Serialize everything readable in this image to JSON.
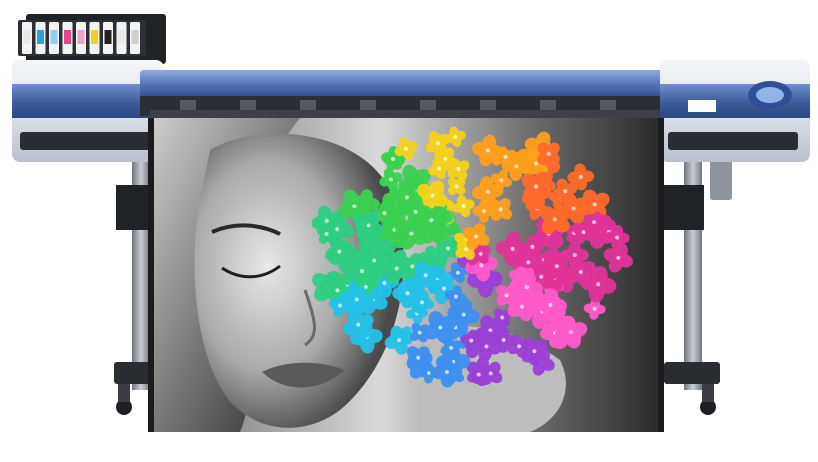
{
  "scene": {
    "subject": "wide-format-inkjet-printer",
    "print_subject": "woman-face-with-rainbow-hydrangea",
    "colors": {
      "background": "#ffffff",
      "printer_blue": "#3f5f9f",
      "printer_body": "#dfe3ea",
      "frame_dark": "#1f2226",
      "stand_grey": "#9aa0a8"
    },
    "ink_cartridges": [
      {
        "name": "ink-cartridge-1",
        "color": "#e9e9e9"
      },
      {
        "name": "ink-cartridge-2",
        "color": "#2aa3dd"
      },
      {
        "name": "ink-cartridge-3",
        "color": "#8fd0ee"
      },
      {
        "name": "ink-cartridge-4",
        "color": "#e2478f"
      },
      {
        "name": "ink-cartridge-5",
        "color": "#f0a2c6"
      },
      {
        "name": "ink-cartridge-6",
        "color": "#f2d21c"
      },
      {
        "name": "ink-cartridge-7",
        "color": "#222222"
      },
      {
        "name": "ink-cartridge-8",
        "color": "#e9e9e9"
      },
      {
        "name": "ink-cartridge-9",
        "color": "#cfcfcf"
      }
    ],
    "petal_palette": [
      "#e0349a",
      "#ff5bc8",
      "#9b3fd6",
      "#3d8ff0",
      "#26c1e8",
      "#2ecf83",
      "#3bd150",
      "#f4d21a",
      "#ff9f1c",
      "#ff6a2b"
    ]
  }
}
